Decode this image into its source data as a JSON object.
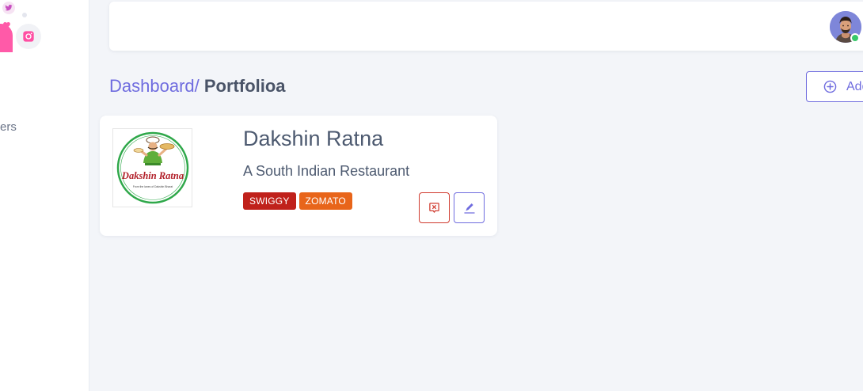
{
  "sidebar": {
    "item_partial_label": "ers",
    "social": [
      {
        "name": "twitter-icon"
      },
      {
        "name": "heart-icon"
      },
      {
        "name": "instagram-icon"
      }
    ]
  },
  "header": {
    "avatar_icon": "user-avatar",
    "status": "online"
  },
  "breadcrumb": {
    "parent": "Dashboard/",
    "current": "Portfolioa"
  },
  "toolbar": {
    "add_label": "Add",
    "add_icon": "plus-circle-icon"
  },
  "portfolio": {
    "title": "Dakshin Ratna",
    "subtitle": "A South Indian Restaurant",
    "logo_text": "Dakshin Ratna",
    "logo_tagline": "From the lanes of Dakshin Bharat",
    "tags": [
      {
        "label": "SWIGGY",
        "color": "#c0211b"
      },
      {
        "label": "ZOMATO",
        "color": "#e8651a"
      }
    ],
    "delete_icon": "delete-icon",
    "edit_icon": "edit-icon"
  },
  "colors": {
    "accent": "#6f6cdf",
    "danger": "#d03a2e",
    "online": "#37c86a"
  }
}
